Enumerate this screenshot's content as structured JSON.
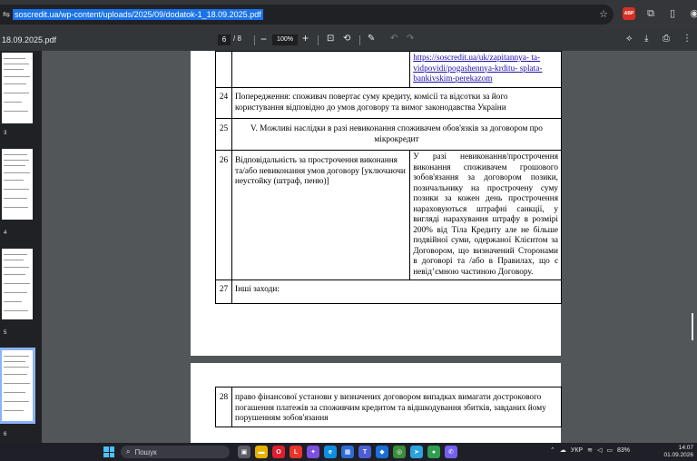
{
  "browser": {
    "url": "soscredit.ua/wp-content/uploads/2025/09/dodatok-1_18.09.2025.pdf",
    "extension_label": "ABP"
  },
  "pdf_toolbar": {
    "file_name": "18.09.2025.pdf",
    "current_page": "6",
    "page_separator": "/",
    "total_pages": "8",
    "zoom": "100%"
  },
  "sidebar": {
    "thumb_labels": [
      "3",
      "4",
      "5",
      "6"
    ]
  },
  "document": {
    "top_link_line1": "https://soscredit.ua/uk/zapitannya-",
    "top_link_line1b": "ta-",
    "top_link_line2": "vidpovidi/pogashennya-krditu-",
    "top_link_line2b": "splata-",
    "top_link_line3": "bankivskim-perekazom",
    "rows": [
      {
        "num": "24",
        "text": "Попередження: споживач повертає суму кредиту, комісії та відсотки за його користування відповідно до умов договору та вимог законодавства України"
      },
      {
        "num": "25",
        "text": "V. Можливі наслідки в разі невиконання споживачем обов'язків за договором про мікрокредит"
      },
      {
        "num": "26",
        "left": "Відповідальність за прострочення виконання та/або невиконання умов договору [уключаючи неустойку (штраф, пеню)]",
        "right": "У разі невиконання/прострочення виконання споживачем грошового зобов'язання за договором позики, позичальнику на прострочену суму позики за кожен день прострочення нараховуються штрафні санкції, у вигляді нарахування штрафу в розмірі 200% від Тіла Кредиту але не більше подвійної суми, одержаної Клієнтом за Договором, що визначений Сторонами в договорі та /або в Правилах, що є невід’ємною частиною Договору."
      },
      {
        "num": "27",
        "text": "Інші заходи:"
      }
    ],
    "page7_row": {
      "num": "28",
      "text": "право фінансової установи у визначених договором випадках вимагати дострокового погашення платежів за споживчим кредитом та відшкодування збитків, завданих йому порушенням зобов'язання"
    }
  },
  "taskbar": {
    "search_placeholder": "Пошук",
    "language": "УКР",
    "battery": "83%",
    "time": "14:07",
    "date": "01.09.2026"
  }
}
